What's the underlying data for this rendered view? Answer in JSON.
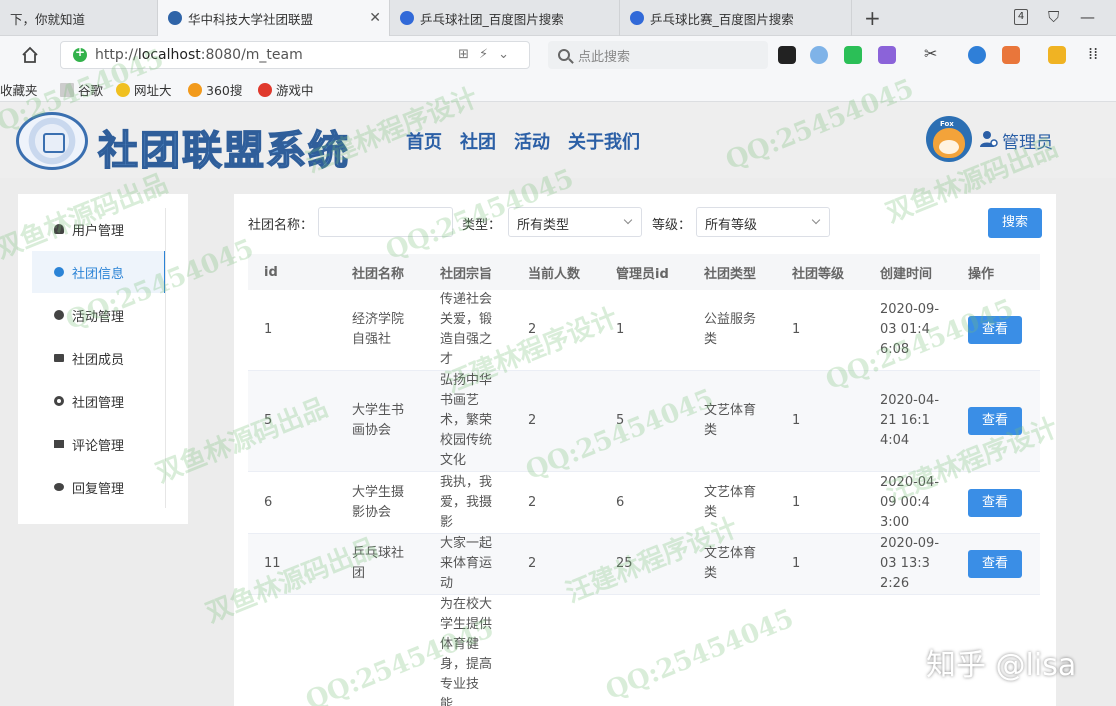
{
  "browser": {
    "tabs": [
      {
        "label": "下，你就知道",
        "active": false
      },
      {
        "label": "华中科技大学社团联盟",
        "active": true
      },
      {
        "label": "乒乓球社团_百度图片搜索",
        "active": false
      },
      {
        "label": "乒乓球比赛_百度图片搜索",
        "active": false
      }
    ],
    "tab_count": "4",
    "url_prefix": "http://",
    "url_host": "localhost",
    "url_rest": ":8080/m_team",
    "search_placeholder": "点此搜索",
    "bookmarks": [
      "收藏夹",
      "谷歌",
      "网址大",
      "360搜",
      "游戏中"
    ]
  },
  "header": {
    "logo_text": "社团联盟系统",
    "nav": [
      "首页",
      "社团",
      "活动",
      "关于我们"
    ],
    "avatar_tag": "Fox",
    "user_label": "管理员"
  },
  "sidebar": {
    "items": [
      {
        "label": "用户管理",
        "active": false
      },
      {
        "label": "社团信息",
        "active": true
      },
      {
        "label": "活动管理",
        "active": false
      },
      {
        "label": "社团成员",
        "active": false
      },
      {
        "label": "社团管理",
        "active": false
      },
      {
        "label": "评论管理",
        "active": false
      },
      {
        "label": "回复管理",
        "active": false
      }
    ]
  },
  "filters": {
    "name_label": "社团名称：",
    "type_label": "类型：",
    "type_value": "所有类型",
    "level_label": "等级：",
    "level_value": "所有等级",
    "search_label": "搜索"
  },
  "table": {
    "headers": [
      "id",
      "社团名称",
      "社团宗旨",
      "当前人数",
      "管理员id",
      "社团类型",
      "社团等级",
      "创建时间",
      "操作"
    ],
    "action_label": "查看",
    "rows": [
      {
        "id": "1",
        "name": "经济学院\n自强社",
        "purpose": "传递社会\n关爱，锻\n造自强之\n才",
        "count": "2",
        "admin": "1",
        "type": "公益服务\n类",
        "level": "1",
        "created": "2020-09-\n03 01:4\n6:08"
      },
      {
        "id": "5",
        "name": "大学生书\n画协会",
        "purpose": "弘扬中华\n书画艺\n术，繁荣\n校园传统\n文化",
        "count": "2",
        "admin": "5",
        "type": "文艺体育\n类",
        "level": "1",
        "created": "2020-04-\n21 16:1\n4:04"
      },
      {
        "id": "6",
        "name": "大学生摄\n影协会",
        "purpose": "我执，我\n爱，我摄\n影",
        "count": "2",
        "admin": "6",
        "type": "文艺体育\n类",
        "level": "1",
        "created": "2020-04-\n09 00:4\n3:00"
      },
      {
        "id": "11",
        "name": "乒乓球社\n团",
        "purpose": "大家一起\n来体育运\n动",
        "count": "2",
        "admin": "25",
        "type": "文艺体育\n类",
        "level": "1",
        "created": "2020-09-\n03 13:3\n2:26"
      },
      {
        "id": "",
        "name": "",
        "purpose": "为在校大\n学生提供\n体育健\n身，提高\n专业技\n能",
        "count": "",
        "admin": "",
        "type": "",
        "level": "",
        "created": ""
      }
    ]
  },
  "watermarks": {
    "qq": "QQ:25454045",
    "fish": "双鱼林源码出品",
    "wang": "汪建林程序设计"
  },
  "credit": "知乎 @lisa"
}
